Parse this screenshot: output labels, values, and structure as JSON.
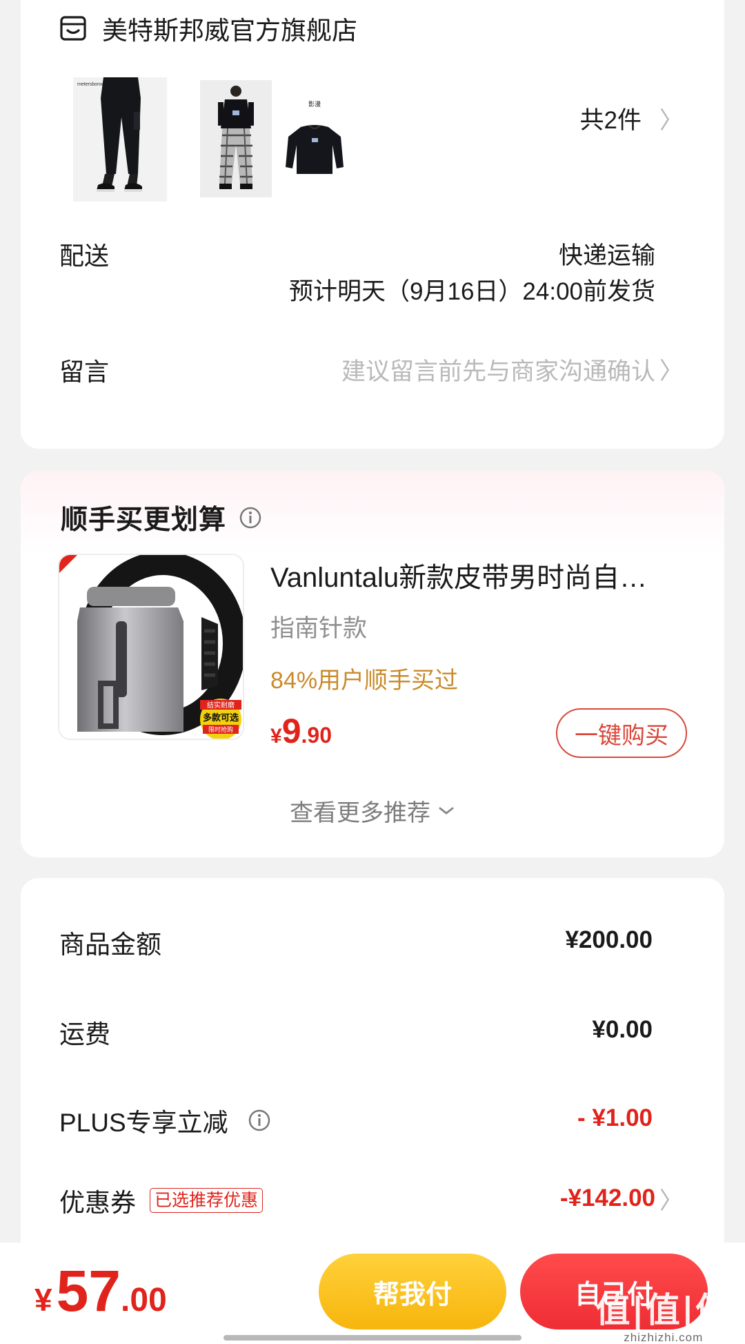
{
  "shop": {
    "name": "美特斯邦威官方旗舰店",
    "item_count_label": "共2件",
    "product_brand_text": "metersbonwe",
    "product_badge_text": "影漫"
  },
  "delivery": {
    "label": "配送",
    "method": "快递运输",
    "eta": "预计明天（9月16日）24:00前发货"
  },
  "message": {
    "label": "留言",
    "placeholder": "建议留言前先与商家沟通确认"
  },
  "recommend": {
    "title": "顺手买更划算",
    "product": {
      "name": "Vanluntalu新款皮带男时尚自…",
      "variant": "指南针款",
      "bought_text": "84%用户顺手买过",
      "price_currency": "¥",
      "price_int": "9",
      "price_dec": ".90",
      "buy_button": "一键购买",
      "badge_top": "结实耐磨",
      "badge_mid": "多款可选",
      "badge_bottom": "限时抢购"
    },
    "more_label": "查看更多推荐"
  },
  "summary": {
    "rows": [
      {
        "label": "商品金额",
        "value": "¥200.00"
      },
      {
        "label": "运费",
        "value": "¥0.00"
      },
      {
        "label": "PLUS专享立减",
        "value": "- ¥1.00"
      },
      {
        "label": "优惠券",
        "tag": "已选推荐优惠",
        "value": "-¥142.00"
      }
    ]
  },
  "footer": {
    "total_currency": "¥",
    "total_int": "57",
    "total_dec": ".00",
    "help_pay": "帮我付",
    "self_pay": "自己付",
    "watermark": "值|值|值",
    "watermark_sub": "zhizhizhi.com"
  },
  "colors": {
    "accent_red": "#e0231b",
    "gold": "#c98a2a",
    "help_pay_yellow": "#f7b50d",
    "self_pay_red": "#ef2d35",
    "page_bg": "#f2f2f2"
  },
  "icons": {
    "shop": "shop-face-icon",
    "info": "info-circle-icon",
    "chevron": "chevron-right-icon",
    "expand": "chevron-down-icon"
  }
}
